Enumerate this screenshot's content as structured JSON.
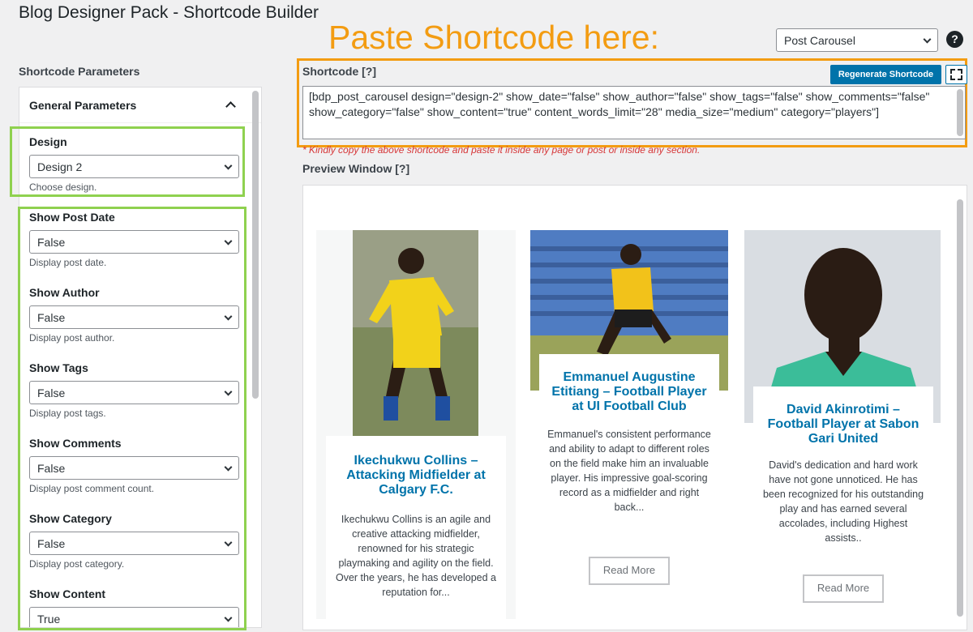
{
  "page": {
    "title": "Blog Designer Pack - Shortcode Builder",
    "annotation": "Paste Shortcode here:"
  },
  "top": {
    "shortcode_type": "Post Carousel",
    "help": "?"
  },
  "left": {
    "heading": "Shortcode Parameters",
    "panel_title": "General Parameters",
    "fields": [
      {
        "label": "Design",
        "value": "Design 2",
        "desc": "Choose design."
      },
      {
        "label": "Show Post Date",
        "value": "False",
        "desc": "Display post date."
      },
      {
        "label": "Show Author",
        "value": "False",
        "desc": "Display post author."
      },
      {
        "label": "Show Tags",
        "value": "False",
        "desc": "Display post tags."
      },
      {
        "label": "Show Comments",
        "value": "False",
        "desc": "Display post comment count."
      },
      {
        "label": "Show Category",
        "value": "False",
        "desc": "Display post category."
      },
      {
        "label": "Show Content",
        "value": "True",
        "desc": ""
      }
    ]
  },
  "shortcode": {
    "heading": "Shortcode [?]",
    "regenerate_label": "Regenerate Shortcode",
    "text": "[bdp_post_carousel design=\"design-2\" show_date=\"false\" show_author=\"false\" show_tags=\"false\" show_comments=\"false\" show_category=\"false\" show_content=\"true\" content_words_limit=\"28\" media_size=\"medium\" category=\"players\"]",
    "note": "* Kindly copy the above shortcode and paste it inside any page or post or inside any section."
  },
  "preview": {
    "heading": "Preview Window [?]",
    "cards": [
      {
        "title": "Ikechukwu Collins – Attacking Midfielder at Calgary F.C.",
        "excerpt": "Ikechukwu Collins is an agile and creative attacking midfielder, renowned for his strategic playmaking and agility on the field. Over the years, he has developed a reputation for...",
        "read_more": ""
      },
      {
        "title": "Emmanuel Augustine Etitiang – Football Player at UI Football Club",
        "excerpt": "Emmanuel's consistent performance and ability to adapt to different roles on the field make him an invaluable player. His impressive goal-scoring record as a midfielder and right back...",
        "read_more": "Read More"
      },
      {
        "title": "David Akinrotimi – Football Player at Sabon Gari United",
        "excerpt": "David's dedication and hard work have not gone unnoticed. He has been recognized for his outstanding play and has earned several accolades, including Highest assists..",
        "read_more": "Read More"
      }
    ]
  },
  "colors": {
    "accent": "#0073aa",
    "highlight_orange": "#f39c12",
    "highlight_green": "#8fd14f",
    "note_red": "#d63638"
  }
}
